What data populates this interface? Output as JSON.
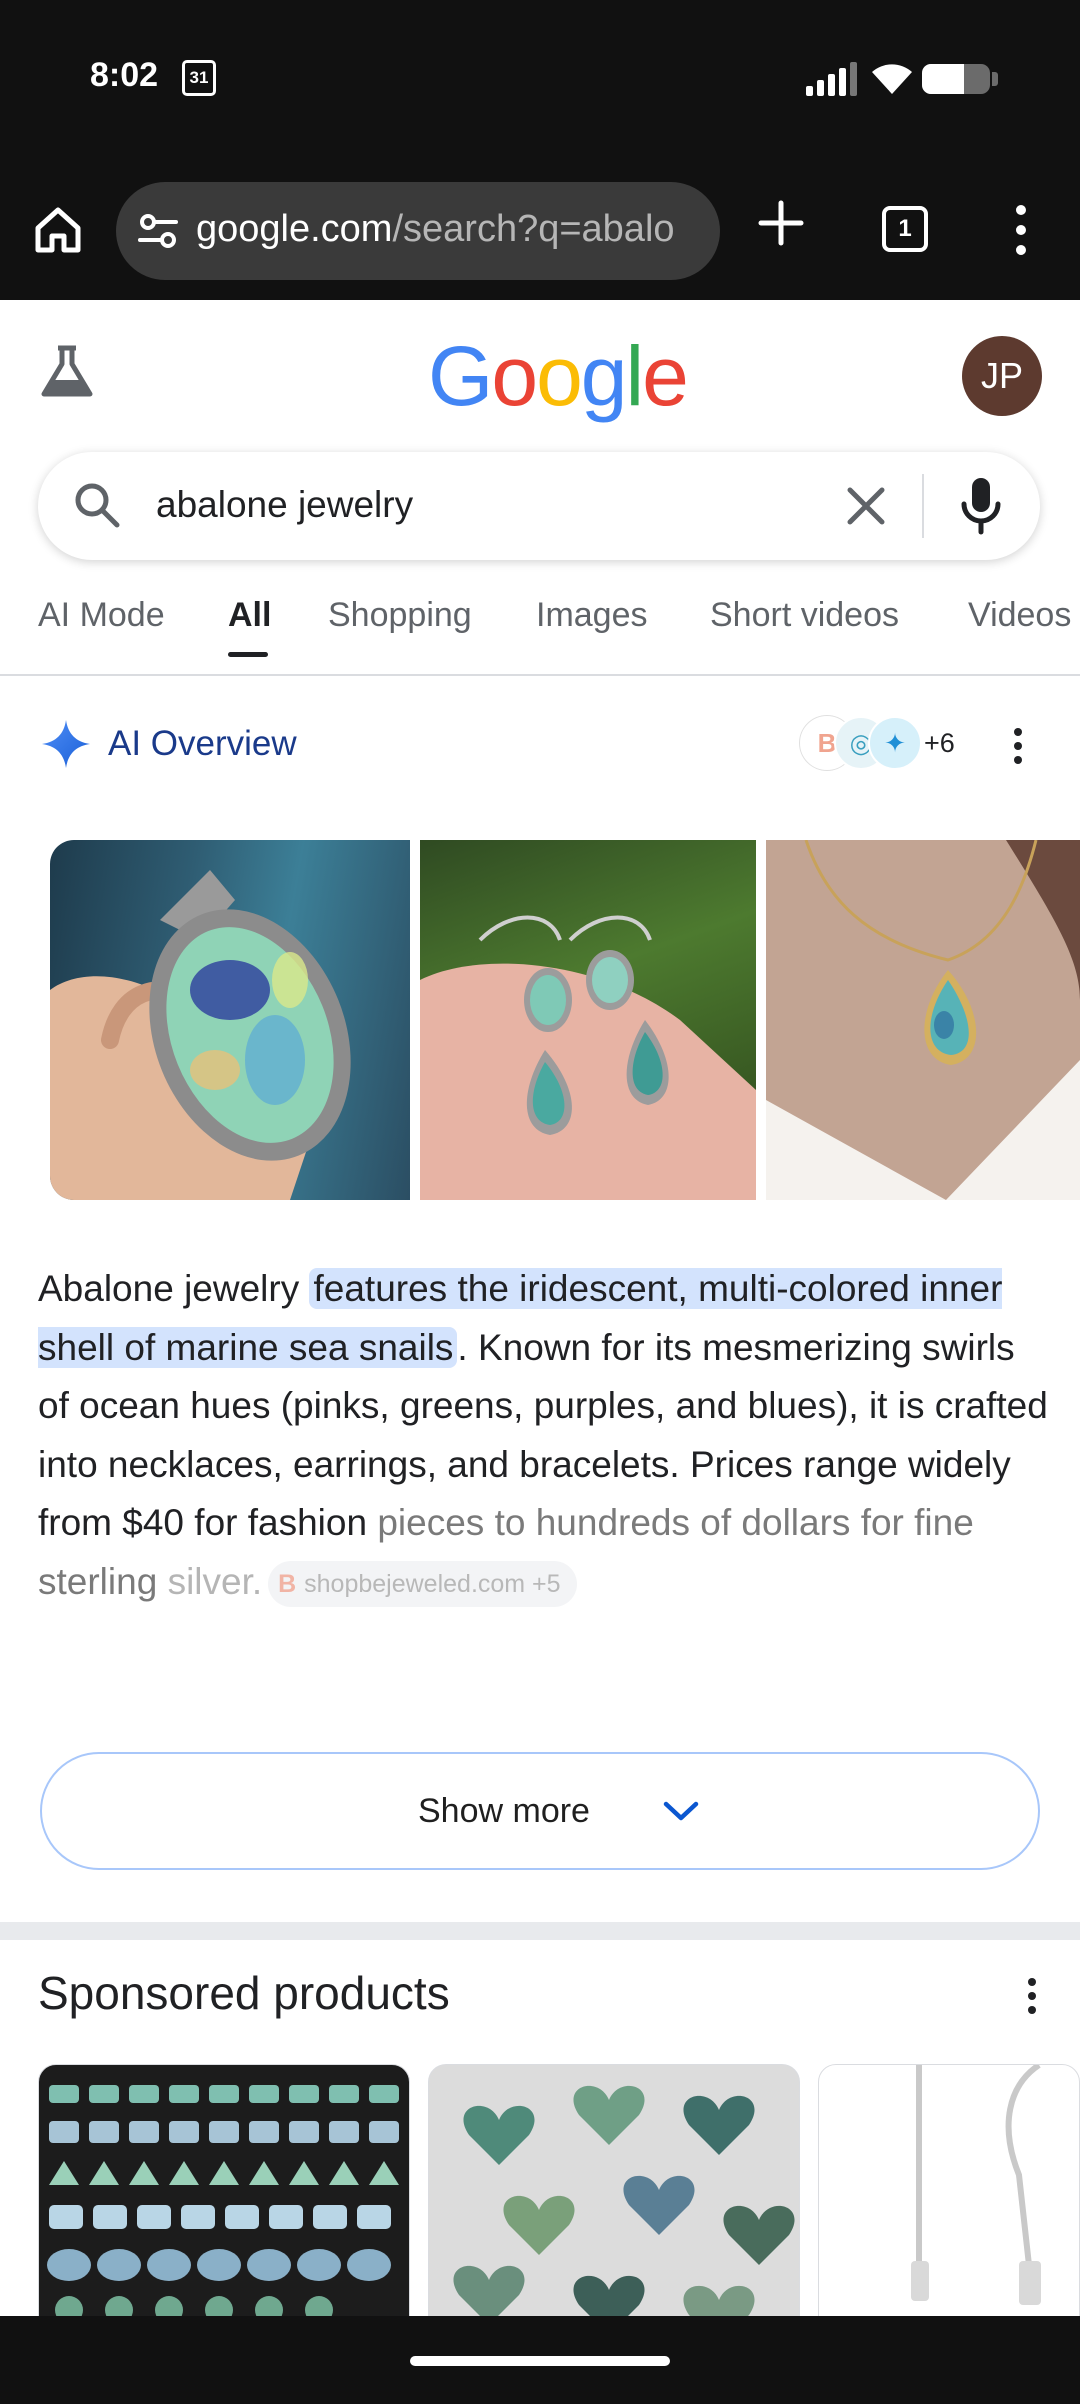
{
  "status_bar": {
    "time": "8:02",
    "calendar_day": "31",
    "battery_level": 0.62
  },
  "browser": {
    "url_host": "google.com",
    "url_path": "/search?q=abalo",
    "tab_count": "1",
    "icons": [
      "home-icon",
      "tune-icon",
      "plus-icon",
      "tabs-icon",
      "more-vert-icon"
    ]
  },
  "google": {
    "logo_letters": [
      "G",
      "o",
      "o",
      "g",
      "l",
      "e"
    ],
    "logo_colors": [
      "#4285F4",
      "#EA4335",
      "#FBBC05",
      "#4285F4",
      "#34A853",
      "#EA4335"
    ],
    "avatar_initials": "JP",
    "avatar_color": "#5d3a2f"
  },
  "search": {
    "query": "abalone jewelry"
  },
  "tabs": [
    {
      "label": "AI Mode",
      "active": false
    },
    {
      "label": "All",
      "active": true
    },
    {
      "label": "Shopping",
      "active": false
    },
    {
      "label": "Images",
      "active": false
    },
    {
      "label": "Short videos",
      "active": false
    },
    {
      "label": "Videos",
      "active": false
    }
  ],
  "ai_overview": {
    "title": "AI Overview",
    "source_count": "+6",
    "text_lead": "Abalone jewelry ",
    "text_highlight": "features the iridescent, multi-colored inner shell of marine sea snails",
    "text_body": ". Known for its mesmerizing swirls of ocean hues (pinks, greens, purples, and blues), it is crafted into necklaces, earrings, and bracelets. Prices range widely from $40 for fashion ",
    "text_fade": "pieces to hundreds of dollars for fine sterling ",
    "text_fade2": "silver.",
    "source_chip": "shopbejeweled.com +5",
    "show_more": "Show more",
    "accent_color": "#1a3a8a",
    "highlight_color": "#d3e3fd"
  },
  "sponsored": {
    "title": "Sponsored products"
  }
}
